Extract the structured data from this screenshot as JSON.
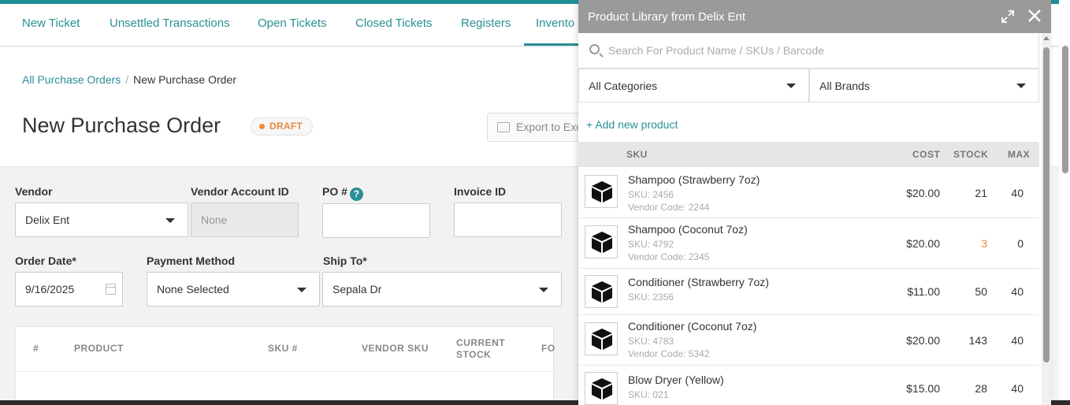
{
  "nav": {
    "items": [
      {
        "label": "New Ticket"
      },
      {
        "label": "Unsettled Transactions"
      },
      {
        "label": "Open Tickets"
      },
      {
        "label": "Closed Tickets"
      },
      {
        "label": "Registers"
      },
      {
        "label": "Invento"
      }
    ],
    "active_index": 5
  },
  "breadcrumb": {
    "parent": "All Purchase Orders",
    "separator": "/",
    "current": "New Purchase Order"
  },
  "page": {
    "title": "New Purchase Order",
    "status_badge": "DRAFT",
    "export_label": "Export to Exc"
  },
  "form": {
    "vendor": {
      "label": "Vendor",
      "value": "Delix Ent"
    },
    "vendor_account_id": {
      "label": "Vendor Account ID",
      "placeholder": "None"
    },
    "po_number": {
      "label": "PO #",
      "help": "?",
      "value": ""
    },
    "invoice_id": {
      "label": "Invoice ID",
      "value": ""
    },
    "order_date": {
      "label": "Order Date*",
      "value": "9/16/2025"
    },
    "payment_method": {
      "label": "Payment Method",
      "value": "None Selected"
    },
    "ship_to": {
      "label": "Ship To*",
      "value": "Sepala Dr"
    }
  },
  "items_table": {
    "headers": {
      "index": "#",
      "product": "PRODUCT",
      "sku": "SKU #",
      "vendor_sku": "VENDOR SKU",
      "current_stock": "CURRENT STOCK",
      "fo": "FO"
    }
  },
  "panel": {
    "title": "Product Library from Delix Ent",
    "search_placeholder": "Search For Product Name / SKUs / Barcode",
    "category_filter": "All Categories",
    "brand_filter": "All Brands",
    "add_new_product": "+ Add new product",
    "columns": {
      "sku": "SKU",
      "cost": "COST",
      "stock": "STOCK",
      "max": "MAX"
    },
    "products": [
      {
        "name": "Shampoo (Strawberry 7oz)",
        "sku": "SKU: 2456",
        "vendor_code": "Vendor Code: 2244",
        "cost": "$20.00",
        "stock": "21",
        "max": "40",
        "low_stock": false
      },
      {
        "name": "Shampoo (Coconut 7oz)",
        "sku": "SKU: 4792",
        "vendor_code": "Vendor Code: 2345",
        "cost": "$20.00",
        "stock": "3",
        "max": "0",
        "low_stock": true
      },
      {
        "name": "Conditioner (Strawberry 7oz)",
        "sku": "SKU: 2356",
        "vendor_code": "",
        "cost": "$11.00",
        "stock": "50",
        "max": "40",
        "low_stock": false
      },
      {
        "name": "Conditioner (Coconut 7oz)",
        "sku": "SKU: 4783",
        "vendor_code": "Vendor Code: 5342",
        "cost": "$20.00",
        "stock": "143",
        "max": "40",
        "low_stock": false
      },
      {
        "name": "Blow Dryer (Yellow)",
        "sku": "SKU: 021",
        "vendor_code": "",
        "cost": "$15.00",
        "stock": "28",
        "max": "40",
        "low_stock": false
      }
    ]
  },
  "colors": {
    "accent": "#2a8f96",
    "draft": "#e98a3b",
    "panel_header": "#9a9a9a"
  },
  "icons": {
    "expand": "expand-icon",
    "close": "close-icon",
    "search": "search-icon",
    "product": "box-icon",
    "calendar": "calendar-icon",
    "help": "help-icon",
    "export": "export-icon"
  }
}
